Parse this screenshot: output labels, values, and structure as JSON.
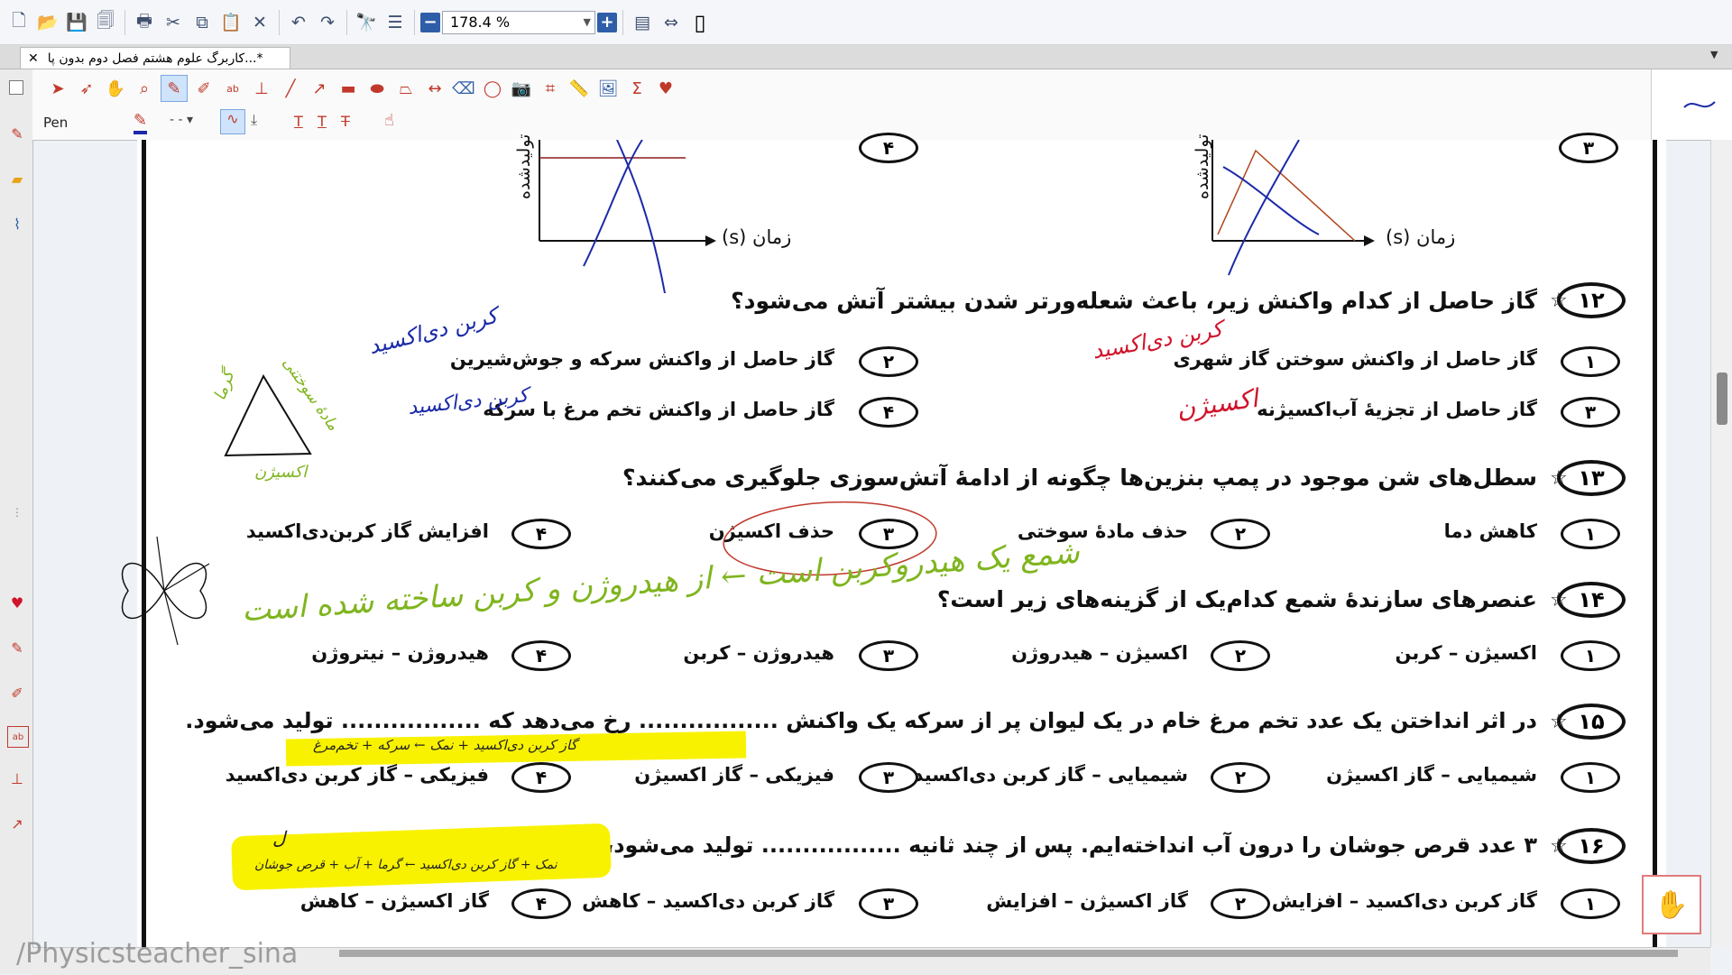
{
  "toolbar": {
    "zoom_value": "178.4 %"
  },
  "tab": {
    "title": "*...کاربرگ علوم هشتم فصل دوم بدون پا",
    "close_glyph": "✕"
  },
  "annotation_toolbar": {
    "tool_label": "Pen"
  },
  "graphs": {
    "xlabel": "زمان (s)",
    "ylabel_partial": "تولیدشده",
    "left_option_number": "۴",
    "right_option_number": "۳"
  },
  "questions": [
    {
      "number": "۱۲",
      "text": "گاز حاصل از کدام واکنش زیر، باعث شعله‌ورتر شدن بیشتر آتش می‌شود؟",
      "options": [
        {
          "num": "۱",
          "text": "گاز حاصل از واکنش سوختن گاز شهری"
        },
        {
          "num": "۲",
          "text": "گاز حاصل از واکنش سرکه و جوش‌شیرین"
        },
        {
          "num": "۳",
          "text": "گاز حاصل از تجزیهٔ آب‌اکسیژنه"
        },
        {
          "num": "۴",
          "text": "گاز حاصل از واکنش تخم مرغ با سرکه"
        }
      ]
    },
    {
      "number": "۱۳",
      "text": "سطل‌های شن موجود در پمپ بنزین‌ها چگونه از ادامهٔ آتش‌سوزی جلوگیری می‌کنند؟",
      "options": [
        {
          "num": "۱",
          "text": "کاهش دما"
        },
        {
          "num": "۲",
          "text": "حذف مادهٔ سوختی"
        },
        {
          "num": "۳",
          "text": "حذف اکسیژن"
        },
        {
          "num": "۴",
          "text": "افزایش گاز کربن‌دی‌اکسید"
        }
      ]
    },
    {
      "number": "۱۴",
      "text": "عنصرهای سازندهٔ شمع کدام‌یک از گزینه‌های زیر است؟",
      "options": [
        {
          "num": "۱",
          "text": "اکسیژن – کربن"
        },
        {
          "num": "۲",
          "text": "اکسیژن – هیدروژن"
        },
        {
          "num": "۳",
          "text": "هیدروژن – کربن"
        },
        {
          "num": "۴",
          "text": "هیدروژن – نیتروژن"
        }
      ]
    },
    {
      "number": "۱۵",
      "text": "در اثر انداختن یک عدد تخم مرغ خام در یک لیوان پر از سرکه یک واکنش ................. رخ می‌دهد که ................. تولید می‌شود.",
      "options": [
        {
          "num": "۱",
          "text": "شیمیایی – گاز اکسیژن"
        },
        {
          "num": "۲",
          "text": "شیمیایی – گاز کربن دی‌اکسید"
        },
        {
          "num": "۳",
          "text": "فیزیکی – گاز اکسیژن"
        },
        {
          "num": "۴",
          "text": "فیزیکی – گاز کربن دی‌اکسید"
        }
      ]
    },
    {
      "number": "۱۶",
      "text": "۳ عدد قرص جوشان را درون آب انداخته‌ایم. پس از چند ثانیه ................. تولید می‌شود، دمای محلول ................. می‌یابد.",
      "options": [
        {
          "num": "۱",
          "text": "گاز کربن دی‌اکسید – افزایش"
        },
        {
          "num": "۲",
          "text": "گاز اکسیژن – افزایش"
        },
        {
          "num": "۳",
          "text": "گاز کربن دی‌اکسید – کاهش"
        },
        {
          "num": "۴",
          "text": "گاز اکسیژن – کاهش"
        }
      ]
    }
  ],
  "handwriting": {
    "q12_opt1": "کربن دی‌اکسید",
    "q12_opt2": "کربن دی‌اکسید",
    "q12_opt3": "اکسیژن",
    "q12_opt4": "کربن دی‌اکسید",
    "triangle_left": "گرما",
    "triangle_right": "مادهٔ سوختنی",
    "triangle_bottom": "اکسیژن",
    "q14_note": "شمع یک هیدروکربن است ← از هیدروژن و کربن ساخته شده است",
    "q15_note": "گاز کربن دی‌اکسید + نمک ← سرکه + تخم‌مرغ",
    "q16_note": "نمک + گاز کربن دی‌اکسید ← گرما + آب + قرص جوشان",
    "q16_small": "ل"
  },
  "watermark": "/Physicsteacher_sina",
  "colors": {
    "accent": "#2f5ea8",
    "pen_red": "#c0392b",
    "ink_blue": "#1b2aa8",
    "ink_red": "#d0142a",
    "ink_green": "#7fb51e",
    "ink_black": "#222222",
    "highlight": "#f8f200"
  }
}
